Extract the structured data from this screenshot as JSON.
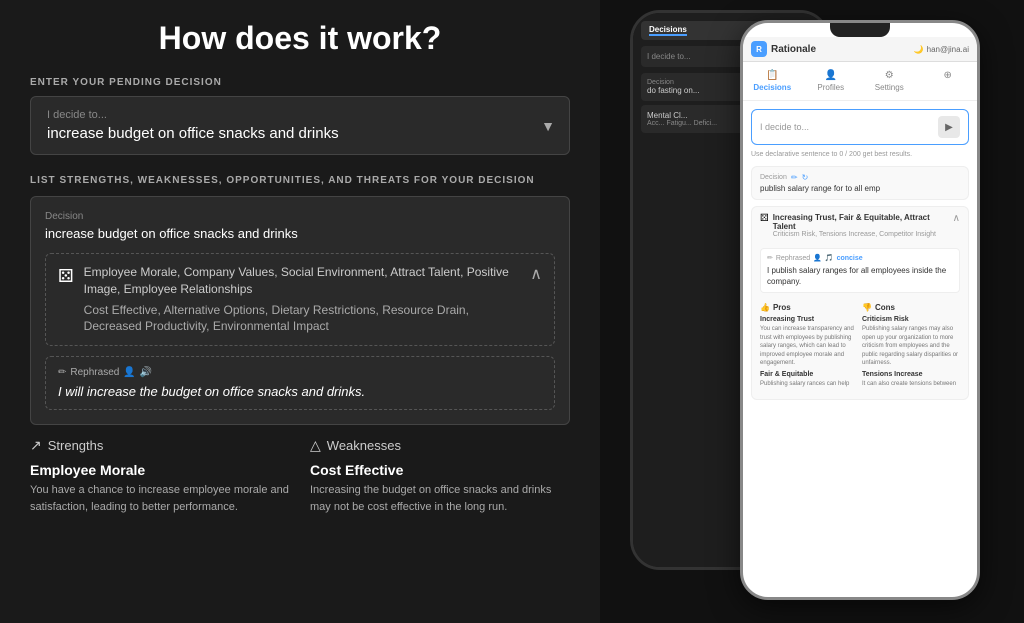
{
  "page": {
    "title": "How does it work?"
  },
  "left": {
    "enter_label": "ENTER YOUR PENDING DECISION",
    "input_placeholder": "I decide to...",
    "input_value": "increase budget on office snacks and drinks",
    "swot_label": "LIST STRENGTHS, WEAKNESSES, OPPORTUNITIES, AND THREATS FOR YOUR DECISION",
    "card": {
      "decision_label": "Decision",
      "decision_value": "increase budget on office snacks and drinks",
      "pros_tags": "Employee Morale, Company Values, Social Environment, Attract Talent, Positive Image, Employee Relationships",
      "cons_tags": "Cost Effective, Alternative Options, Dietary Restrictions, Resource Drain, Decreased Productivity, Environmental Impact",
      "rephrased_label": "Rephrased",
      "rephrased_value": "I will increase the budget on office snacks and drinks."
    },
    "strengths": {
      "label": "Strengths",
      "item_title": "Employee Morale",
      "item_desc": "You have a chance to increase employee morale and satisfaction, leading to better performance."
    },
    "weaknesses": {
      "label": "Weaknesses",
      "item_title": "Cost Effective",
      "item_desc": "Increasing the budget on office snacks and drinks may not be cost effective in the long run."
    }
  },
  "phone_back": {
    "logo": "Rationale",
    "tab_decisions": "Decisions",
    "input_placeholder": "I decide to...",
    "decision_label": "Decision",
    "decision_value": "do fasting on...",
    "analysis_label": "Mental Cl...",
    "analysis_sub": "Acc... Fatigu... Defici..."
  },
  "phone_front": {
    "logo": "Rationale",
    "user": "han@jina.ai",
    "nav": {
      "decisions": "Decisions",
      "profiles": "Profiles",
      "settings": "Settings"
    },
    "input_placeholder": "I decide to...",
    "hint": "Use declarative sentence to  0 / 200\nget best results.",
    "decision": {
      "label": "Decision",
      "value": "publish salary range for to all emp"
    },
    "analysis": {
      "title": "Increasing Trust, Fair & Equitable, Attract Talent",
      "subtitle": "Criticism Risk, Tensions Increase, Competitor Insight"
    },
    "rephrased_badge": "Rephrased",
    "rephrased_text": "I publish salary ranges for all employees inside the company.",
    "pros_label": "Pros",
    "cons_label": "Cons",
    "pros": [
      {
        "title": "Increasing Trust",
        "desc": "You can increase transparency and trust with employees by publishing salary ranges, which can lead to improved employee morale and engagement."
      },
      {
        "title": "Fair & Equitable",
        "desc": "Publishing salary rances can help"
      }
    ],
    "cons": [
      {
        "title": "Criticism Risk",
        "desc": "Publishing salary ranges may also open up your organization to more criticism from employees and the public regarding salary disparities or unfairness."
      },
      {
        "title": "Tensions Increase",
        "desc": "It can also create tensions between"
      }
    ]
  }
}
